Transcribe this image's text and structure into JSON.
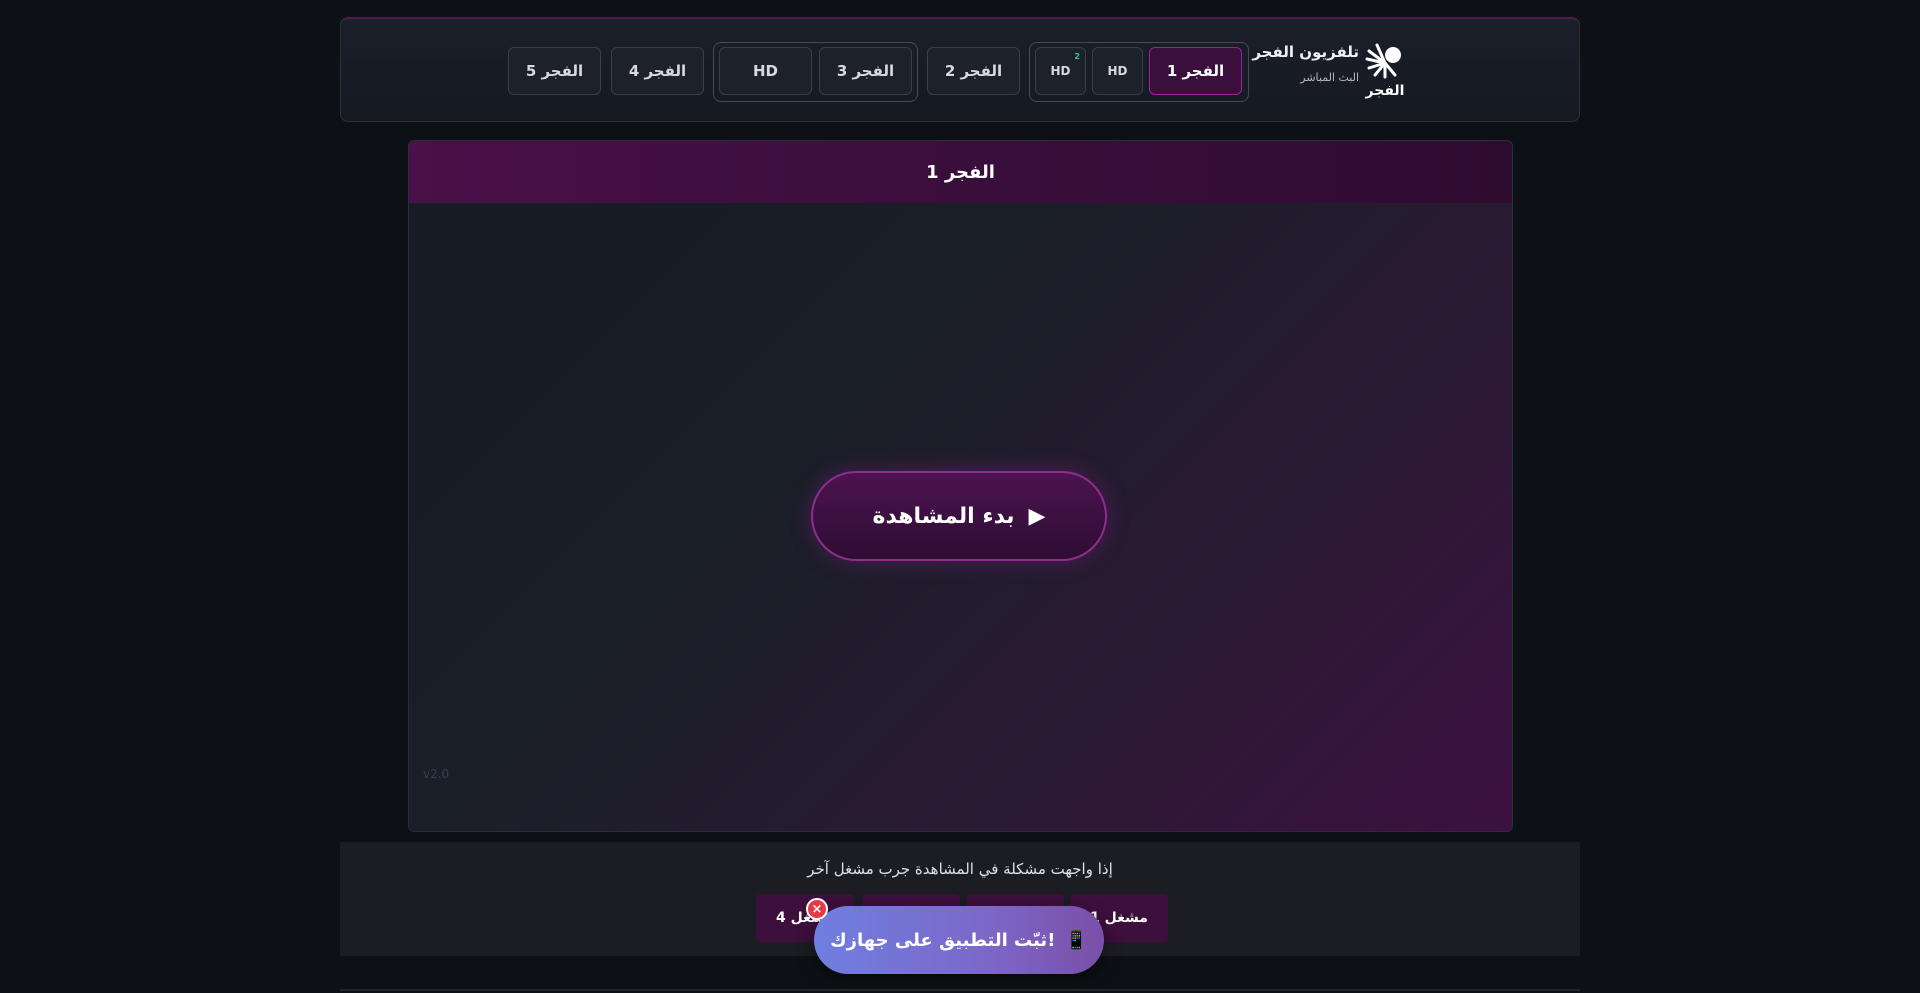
{
  "brand": {
    "name": "تلفزيون الفجر",
    "tagline": "البث المباشر",
    "logo_word": "الفجر"
  },
  "channels": {
    "fajr1": "الفجر 1",
    "hd_a": "HD",
    "hd_b": "HD",
    "hd_b_sup": "2",
    "fajr2": "الفجر 2",
    "fajr3": "الفجر 3",
    "hd_c": "HD",
    "fajr4": "الفجر 4",
    "fajr5": "الفجر 5"
  },
  "player": {
    "title": "الفجر 1",
    "play_label": "بدء المشاهدة",
    "play_icon": "▶",
    "watermark": "v2.0"
  },
  "notice": {
    "text": "إذا واجهت مشكلة في المشاهدة جرب مشغل آخر",
    "server_1": "مشغل 1",
    "server_4": "مشغل 4"
  },
  "install": {
    "label": "ثبّت التطبيق على جهازك!",
    "icon": "📱",
    "close": "×"
  },
  "colors": {
    "accent": "#a01fa0",
    "active_bg": "#3a0f3c",
    "install_from": "#6f7fe0",
    "install_to": "#7a4fa8"
  }
}
